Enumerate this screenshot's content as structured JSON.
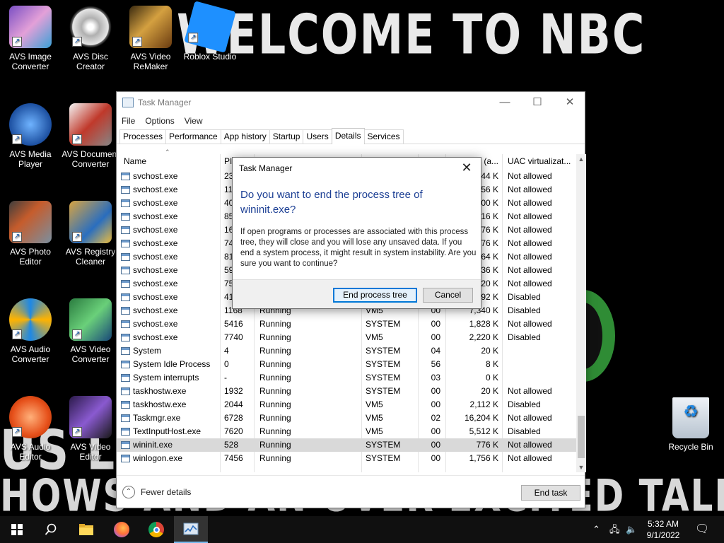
{
  "wallpaper": {
    "title": "WELCOME TO NBC",
    "line2": "US L  NE  CE BREAK",
    "line3": "HOWS  AND  AN  OVER  EXCITED  TALK SHOW HO"
  },
  "desktop_icons": [
    {
      "label": "AVS Image Converter"
    },
    {
      "label": "AVS Disc Creator"
    },
    {
      "label": "AVS Video ReMaker"
    },
    {
      "label": "Roblox Studio"
    },
    {
      "label": "AVS Media Player"
    },
    {
      "label": "AVS Document Converter"
    },
    {
      "label": "AVS Photo Editor"
    },
    {
      "label": "AVS Registry Cleaner"
    },
    {
      "label": "AVS Audio Converter"
    },
    {
      "label": "AVS Video Converter"
    },
    {
      "label": "AVS Audio Editor"
    },
    {
      "label": "AVS Video Editor"
    },
    {
      "label": "Recycle Bin"
    }
  ],
  "taskmgr": {
    "title": "Task Manager",
    "menu": [
      "File",
      "Options",
      "View"
    ],
    "tabs": [
      "Processes",
      "Performance",
      "App history",
      "Startup",
      "Users",
      "Details",
      "Services"
    ],
    "active_tab": "Details",
    "columns": {
      "name": "Name",
      "pid": "PI",
      "status": "",
      "user": "",
      "cpu": "",
      "memory": "y (a...",
      "uac": "UAC virtualizat..."
    },
    "rows": [
      {
        "name": "svchost.exe",
        "pid": "23",
        "status": "",
        "user": "",
        "cpu": "",
        "mem": "44 K",
        "uac": "Not allowed"
      },
      {
        "name": "svchost.exe",
        "pid": "11",
        "status": "",
        "user": "",
        "cpu": "",
        "mem": "56 K",
        "uac": "Not allowed"
      },
      {
        "name": "svchost.exe",
        "pid": "40",
        "status": "",
        "user": "",
        "cpu": "",
        "mem": "00 K",
        "uac": "Not allowed"
      },
      {
        "name": "svchost.exe",
        "pid": "85",
        "status": "",
        "user": "",
        "cpu": "",
        "mem": "16 K",
        "uac": "Not allowed"
      },
      {
        "name": "svchost.exe",
        "pid": "16",
        "status": "",
        "user": "",
        "cpu": "",
        "mem": "76 K",
        "uac": "Not allowed"
      },
      {
        "name": "svchost.exe",
        "pid": "74",
        "status": "",
        "user": "",
        "cpu": "",
        "mem": "76 K",
        "uac": "Not allowed"
      },
      {
        "name": "svchost.exe",
        "pid": "81",
        "status": "",
        "user": "",
        "cpu": "",
        "mem": "64 K",
        "uac": "Not allowed"
      },
      {
        "name": "svchost.exe",
        "pid": "59",
        "status": "",
        "user": "",
        "cpu": "",
        "mem": "36 K",
        "uac": "Not allowed"
      },
      {
        "name": "svchost.exe",
        "pid": "75",
        "status": "",
        "user": "",
        "cpu": "",
        "mem": "20 K",
        "uac": "Not allowed"
      },
      {
        "name": "svchost.exe",
        "pid": "41",
        "status": "",
        "user": "",
        "cpu": "",
        "mem": "92 K",
        "uac": "Disabled"
      },
      {
        "name": "svchost.exe",
        "pid": "1168",
        "status": "Running",
        "user": "VM5",
        "cpu": "00",
        "mem": "7,340 K",
        "uac": "Disabled"
      },
      {
        "name": "svchost.exe",
        "pid": "5416",
        "status": "Running",
        "user": "SYSTEM",
        "cpu": "00",
        "mem": "1,828 K",
        "uac": "Not allowed"
      },
      {
        "name": "svchost.exe",
        "pid": "7740",
        "status": "Running",
        "user": "VM5",
        "cpu": "00",
        "mem": "2,220 K",
        "uac": "Disabled"
      },
      {
        "name": "System",
        "pid": "4",
        "status": "Running",
        "user": "SYSTEM",
        "cpu": "04",
        "mem": "20 K",
        "uac": ""
      },
      {
        "name": "System Idle Process",
        "pid": "0",
        "status": "Running",
        "user": "SYSTEM",
        "cpu": "56",
        "mem": "8 K",
        "uac": ""
      },
      {
        "name": "System interrupts",
        "pid": "-",
        "status": "Running",
        "user": "SYSTEM",
        "cpu": "03",
        "mem": "0 K",
        "uac": ""
      },
      {
        "name": "taskhostw.exe",
        "pid": "1932",
        "status": "Running",
        "user": "SYSTEM",
        "cpu": "00",
        "mem": "20 K",
        "uac": "Not allowed"
      },
      {
        "name": "taskhostw.exe",
        "pid": "2044",
        "status": "Running",
        "user": "VM5",
        "cpu": "00",
        "mem": "2,112 K",
        "uac": "Disabled"
      },
      {
        "name": "Taskmgr.exe",
        "pid": "6728",
        "status": "Running",
        "user": "VM5",
        "cpu": "02",
        "mem": "16,204 K",
        "uac": "Not allowed"
      },
      {
        "name": "TextInputHost.exe",
        "pid": "7620",
        "status": "Running",
        "user": "VM5",
        "cpu": "00",
        "mem": "5,512 K",
        "uac": "Disabled"
      },
      {
        "name": "wininit.exe",
        "pid": "528",
        "status": "Running",
        "user": "SYSTEM",
        "cpu": "00",
        "mem": "776 K",
        "uac": "Not allowed",
        "selected": true
      },
      {
        "name": "winlogon.exe",
        "pid": "7456",
        "status": "Running",
        "user": "SYSTEM",
        "cpu": "00",
        "mem": "1,756 K",
        "uac": "Not allowed"
      }
    ],
    "fewer_details": "Fewer details",
    "end_task": "End task"
  },
  "dialog": {
    "title": "Task Manager",
    "heading": "Do you want to end the process tree of wininit.exe?",
    "body": "If open programs or processes are associated with this process tree, they will close and you will lose any unsaved data. If you end a system process, it might result in system instability. Are you sure you want to continue?",
    "primary_button": "End process tree",
    "cancel_button": "Cancel"
  },
  "taskbar": {
    "time": "5:32 AM",
    "date": "9/1/2022"
  },
  "colors": {
    "dialog_heading": "#1c3f94",
    "primary_button_border": "#0078d7",
    "selected_row": "#d9d9d9",
    "taskbar": "#101010"
  }
}
